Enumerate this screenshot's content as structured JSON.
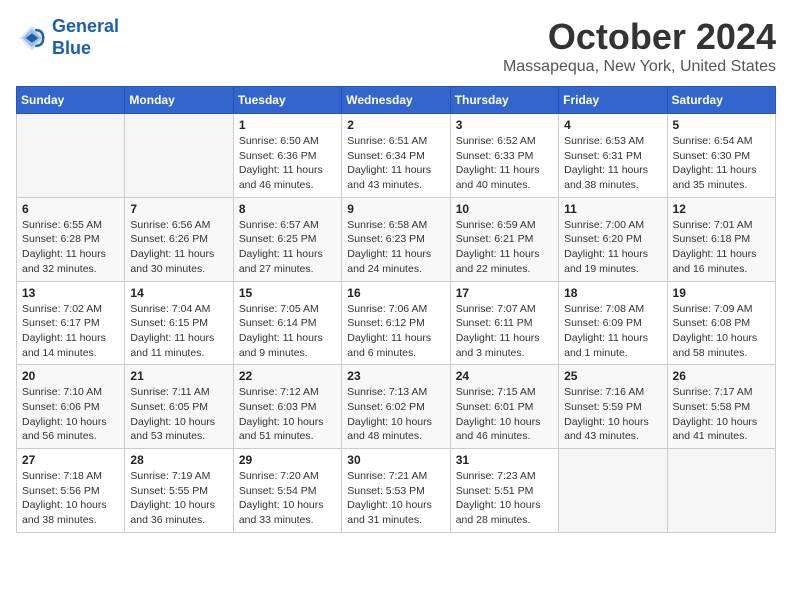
{
  "logo": {
    "line1": "General",
    "line2": "Blue"
  },
  "header": {
    "month": "October 2024",
    "location": "Massapequa, New York, United States"
  },
  "weekdays": [
    "Sunday",
    "Monday",
    "Tuesday",
    "Wednesday",
    "Thursday",
    "Friday",
    "Saturday"
  ],
  "weeks": [
    [
      {
        "day": "",
        "info": ""
      },
      {
        "day": "",
        "info": ""
      },
      {
        "day": "1",
        "info": "Sunrise: 6:50 AM\nSunset: 6:36 PM\nDaylight: 11 hours and 46 minutes."
      },
      {
        "day": "2",
        "info": "Sunrise: 6:51 AM\nSunset: 6:34 PM\nDaylight: 11 hours and 43 minutes."
      },
      {
        "day": "3",
        "info": "Sunrise: 6:52 AM\nSunset: 6:33 PM\nDaylight: 11 hours and 40 minutes."
      },
      {
        "day": "4",
        "info": "Sunrise: 6:53 AM\nSunset: 6:31 PM\nDaylight: 11 hours and 38 minutes."
      },
      {
        "day": "5",
        "info": "Sunrise: 6:54 AM\nSunset: 6:30 PM\nDaylight: 11 hours and 35 minutes."
      }
    ],
    [
      {
        "day": "6",
        "info": "Sunrise: 6:55 AM\nSunset: 6:28 PM\nDaylight: 11 hours and 32 minutes."
      },
      {
        "day": "7",
        "info": "Sunrise: 6:56 AM\nSunset: 6:26 PM\nDaylight: 11 hours and 30 minutes."
      },
      {
        "day": "8",
        "info": "Sunrise: 6:57 AM\nSunset: 6:25 PM\nDaylight: 11 hours and 27 minutes."
      },
      {
        "day": "9",
        "info": "Sunrise: 6:58 AM\nSunset: 6:23 PM\nDaylight: 11 hours and 24 minutes."
      },
      {
        "day": "10",
        "info": "Sunrise: 6:59 AM\nSunset: 6:21 PM\nDaylight: 11 hours and 22 minutes."
      },
      {
        "day": "11",
        "info": "Sunrise: 7:00 AM\nSunset: 6:20 PM\nDaylight: 11 hours and 19 minutes."
      },
      {
        "day": "12",
        "info": "Sunrise: 7:01 AM\nSunset: 6:18 PM\nDaylight: 11 hours and 16 minutes."
      }
    ],
    [
      {
        "day": "13",
        "info": "Sunrise: 7:02 AM\nSunset: 6:17 PM\nDaylight: 11 hours and 14 minutes."
      },
      {
        "day": "14",
        "info": "Sunrise: 7:04 AM\nSunset: 6:15 PM\nDaylight: 11 hours and 11 minutes."
      },
      {
        "day": "15",
        "info": "Sunrise: 7:05 AM\nSunset: 6:14 PM\nDaylight: 11 hours and 9 minutes."
      },
      {
        "day": "16",
        "info": "Sunrise: 7:06 AM\nSunset: 6:12 PM\nDaylight: 11 hours and 6 minutes."
      },
      {
        "day": "17",
        "info": "Sunrise: 7:07 AM\nSunset: 6:11 PM\nDaylight: 11 hours and 3 minutes."
      },
      {
        "day": "18",
        "info": "Sunrise: 7:08 AM\nSunset: 6:09 PM\nDaylight: 11 hours and 1 minute."
      },
      {
        "day": "19",
        "info": "Sunrise: 7:09 AM\nSunset: 6:08 PM\nDaylight: 10 hours and 58 minutes."
      }
    ],
    [
      {
        "day": "20",
        "info": "Sunrise: 7:10 AM\nSunset: 6:06 PM\nDaylight: 10 hours and 56 minutes."
      },
      {
        "day": "21",
        "info": "Sunrise: 7:11 AM\nSunset: 6:05 PM\nDaylight: 10 hours and 53 minutes."
      },
      {
        "day": "22",
        "info": "Sunrise: 7:12 AM\nSunset: 6:03 PM\nDaylight: 10 hours and 51 minutes."
      },
      {
        "day": "23",
        "info": "Sunrise: 7:13 AM\nSunset: 6:02 PM\nDaylight: 10 hours and 48 minutes."
      },
      {
        "day": "24",
        "info": "Sunrise: 7:15 AM\nSunset: 6:01 PM\nDaylight: 10 hours and 46 minutes."
      },
      {
        "day": "25",
        "info": "Sunrise: 7:16 AM\nSunset: 5:59 PM\nDaylight: 10 hours and 43 minutes."
      },
      {
        "day": "26",
        "info": "Sunrise: 7:17 AM\nSunset: 5:58 PM\nDaylight: 10 hours and 41 minutes."
      }
    ],
    [
      {
        "day": "27",
        "info": "Sunrise: 7:18 AM\nSunset: 5:56 PM\nDaylight: 10 hours and 38 minutes."
      },
      {
        "day": "28",
        "info": "Sunrise: 7:19 AM\nSunset: 5:55 PM\nDaylight: 10 hours and 36 minutes."
      },
      {
        "day": "29",
        "info": "Sunrise: 7:20 AM\nSunset: 5:54 PM\nDaylight: 10 hours and 33 minutes."
      },
      {
        "day": "30",
        "info": "Sunrise: 7:21 AM\nSunset: 5:53 PM\nDaylight: 10 hours and 31 minutes."
      },
      {
        "day": "31",
        "info": "Sunrise: 7:23 AM\nSunset: 5:51 PM\nDaylight: 10 hours and 28 minutes."
      },
      {
        "day": "",
        "info": ""
      },
      {
        "day": "",
        "info": ""
      }
    ]
  ]
}
